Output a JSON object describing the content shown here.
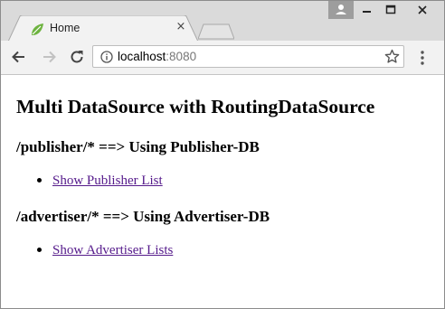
{
  "browser": {
    "tab": {
      "title": "Home",
      "close_glyph": "×",
      "favicon": "spring-leaf-icon"
    },
    "toolbar": {
      "back_icon": "back-arrow-icon",
      "forward_icon": "forward-arrow-icon",
      "reload_icon": "reload-icon",
      "url_host": "localhost",
      "url_port": ":8080",
      "bookmark_icon": "star-icon",
      "menu_icon": "kebab-menu-icon"
    },
    "colors": {
      "frame": "#dadada",
      "toolbar": "#f2f2f2",
      "link_visited": "#551a8b",
      "favicon": "#6db33f"
    }
  },
  "page": {
    "heading": "Multi DataSource with RoutingDataSource",
    "sections": [
      {
        "heading": "/publisher/* ==> Using Publisher-DB",
        "link": "Show Publisher List"
      },
      {
        "heading": "/advertiser/* ==> Using Advertiser-DB",
        "link": "Show Advertiser Lists"
      }
    ]
  }
}
